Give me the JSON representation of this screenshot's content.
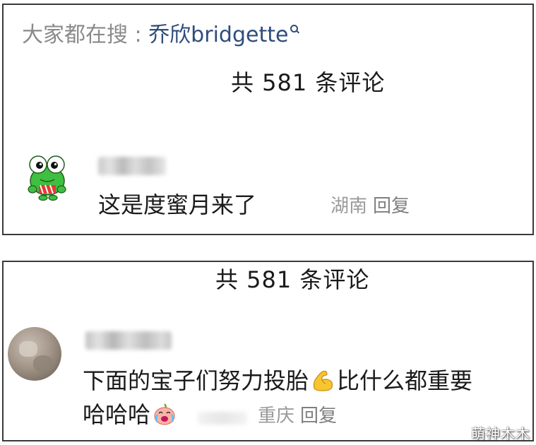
{
  "screenshot_1": {
    "search_hint": {
      "prefix": "大家都在搜 : ",
      "term": "乔欣bridgette"
    },
    "comment_count": "共 581 条评论",
    "comment": {
      "text": "这是度蜜月来了",
      "location": "湖南",
      "reply_label": "回复"
    }
  },
  "screenshot_2": {
    "comment_count": "共 581 条评论",
    "comment": {
      "text_part_1": "下面的宝子们努力投胎",
      "text_part_2": "比什么都重要",
      "text_line_2": "哈哈哈",
      "location": "重庆",
      "reply_label": "回复"
    }
  },
  "watermark": "萌神木木",
  "icons": [
    "search-icon",
    "frog-avatar-icon",
    "flexed-biceps-icon",
    "crying-laughing-icon"
  ],
  "colors": {
    "search_prefix": "#8a8a8a",
    "search_term": "#2e4d7a",
    "meta_text": "#9a9a9a",
    "border": "#3a3a3a"
  }
}
